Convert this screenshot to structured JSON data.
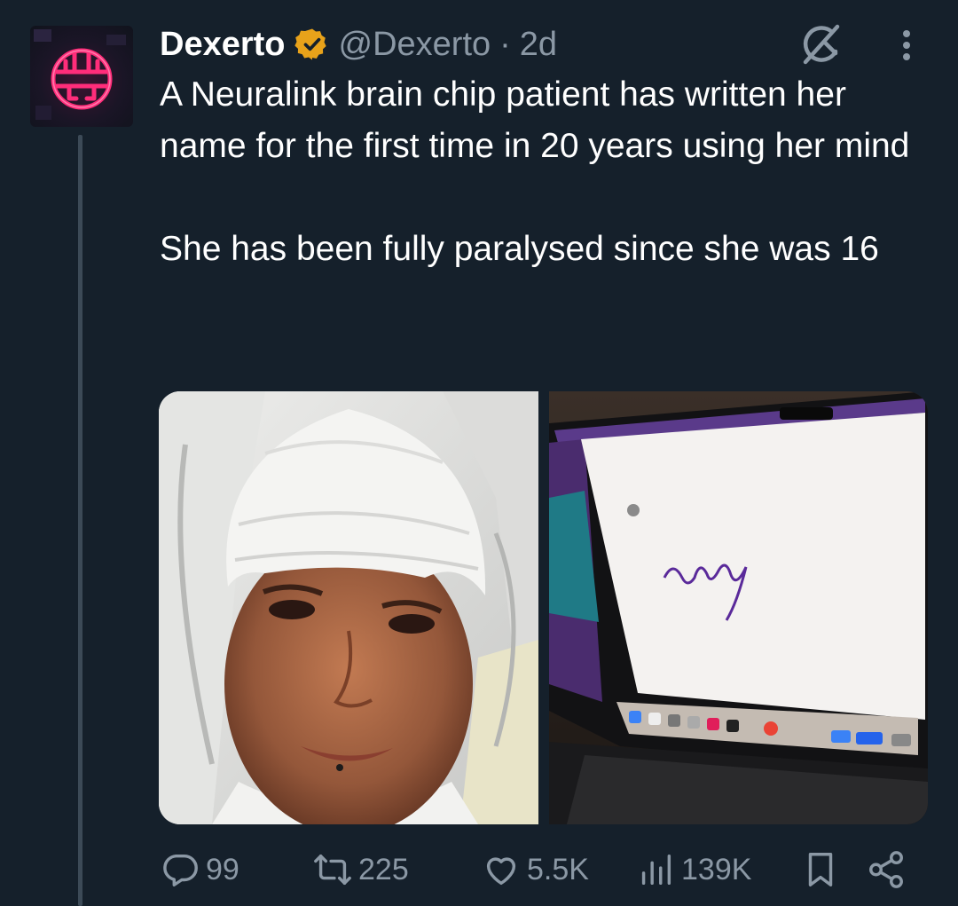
{
  "author": {
    "name": "Dexerto",
    "handle": "@Dexerto",
    "separator": "·",
    "time": "2d",
    "verified": true,
    "badge_color": "#e8a21a"
  },
  "tweet": {
    "paragraph_1": "A Neuralink brain chip patient has written her name for the first time in 20 years using her mind",
    "paragraph_2": "She has been fully paralysed since she was 16"
  },
  "media": {
    "count": 2,
    "images": [
      "patient-with-bandaged-head",
      "laptop-whiteboard-signature"
    ],
    "signature_text": "audrey"
  },
  "actions": {
    "replies": "99",
    "reposts": "225",
    "likes": "5.5K",
    "views": "139K"
  },
  "icons": [
    "verified-badge-icon",
    "grok-icon",
    "more-icon",
    "reply-icon",
    "repost-icon",
    "like-icon",
    "views-icon",
    "bookmark-icon",
    "share-icon"
  ],
  "colors": {
    "background": "#15202b",
    "text": "#ffffff",
    "muted": "#8b98a5",
    "thread_line": "#3c4a57",
    "avatar_neon": "#ff2d7a"
  }
}
